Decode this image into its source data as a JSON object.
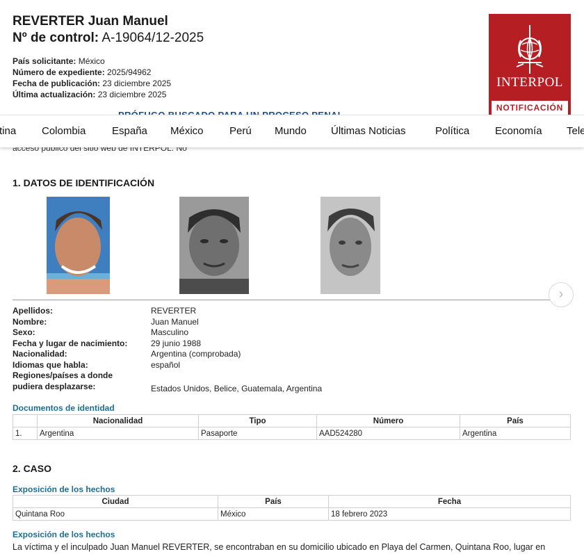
{
  "header": {
    "name": "REVERTER Juan Manuel",
    "control_label": "Nº de control:",
    "control_value": "A-19064/12-2025",
    "meta": [
      {
        "label": "País solicitante:",
        "value": "México"
      },
      {
        "label": "Número de expediente:",
        "value": "2025/94962"
      },
      {
        "label": "Fecha de publicación:",
        "value": "23 diciembre 2025"
      },
      {
        "label": "Última actualización:",
        "value": "23 diciembre 2025"
      }
    ],
    "banner": "PRÓFUGO BUSCADO PARA UN PROCESO PENAL",
    "access_note": "acceso público del sitio web de INTERPOL: No"
  },
  "logo": {
    "word": "INTERPOL",
    "notice": "NOTIFICACIÓN",
    "color": "#b51f24"
  },
  "nav": {
    "items": [
      "tina",
      "Colombia",
      "España",
      "México",
      "Perú",
      "Mundo",
      "Últimas Noticias",
      "Política",
      "Economía",
      "Tele"
    ]
  },
  "section1": {
    "title": "1. DATOS DE IDENTIFICACIÓN",
    "fields": [
      {
        "label": "Apellidos:",
        "value": "REVERTER"
      },
      {
        "label": "Nombre:",
        "value": "Juan Manuel"
      },
      {
        "label": "Sexo:",
        "value": "Masculino"
      },
      {
        "label": "Fecha y lugar de nacimiento:",
        "value": "29 junio 1988"
      },
      {
        "label": "Nacionalidad:",
        "value": "Argentina (comprobada)"
      },
      {
        "label": "Idiomas que habla:",
        "value": "español"
      },
      {
        "label": "Regiones/países a donde",
        "value": ""
      },
      {
        "label": "pudiera desplazarse:",
        "value": "Estados Unidos, Belice, Guatemala, Argentina"
      }
    ],
    "docs_title": "Documentos de identidad",
    "docs_headers": [
      "",
      "Nacionalidad",
      "Tipo",
      "Número",
      "País"
    ],
    "docs_rows": [
      [
        "1.",
        "Argentina",
        "Pasaporte",
        "AAD524280",
        "Argentina"
      ]
    ]
  },
  "section2": {
    "title": "2. CASO",
    "facts_title": "Exposición de los hechos",
    "case_headers": [
      "Ciudad",
      "País",
      "Fecha"
    ],
    "case_rows": [
      [
        "Quintana Roo",
        "México",
        "18 febrero 2023"
      ]
    ],
    "facts_title2": "Exposición de los hechos",
    "facts_text": "La víctima y el inculpado Juan Manuel REVERTER, se encontraban en su domicilio ubicado en Playa del Carmen, Quintana Roo, lugar en"
  }
}
